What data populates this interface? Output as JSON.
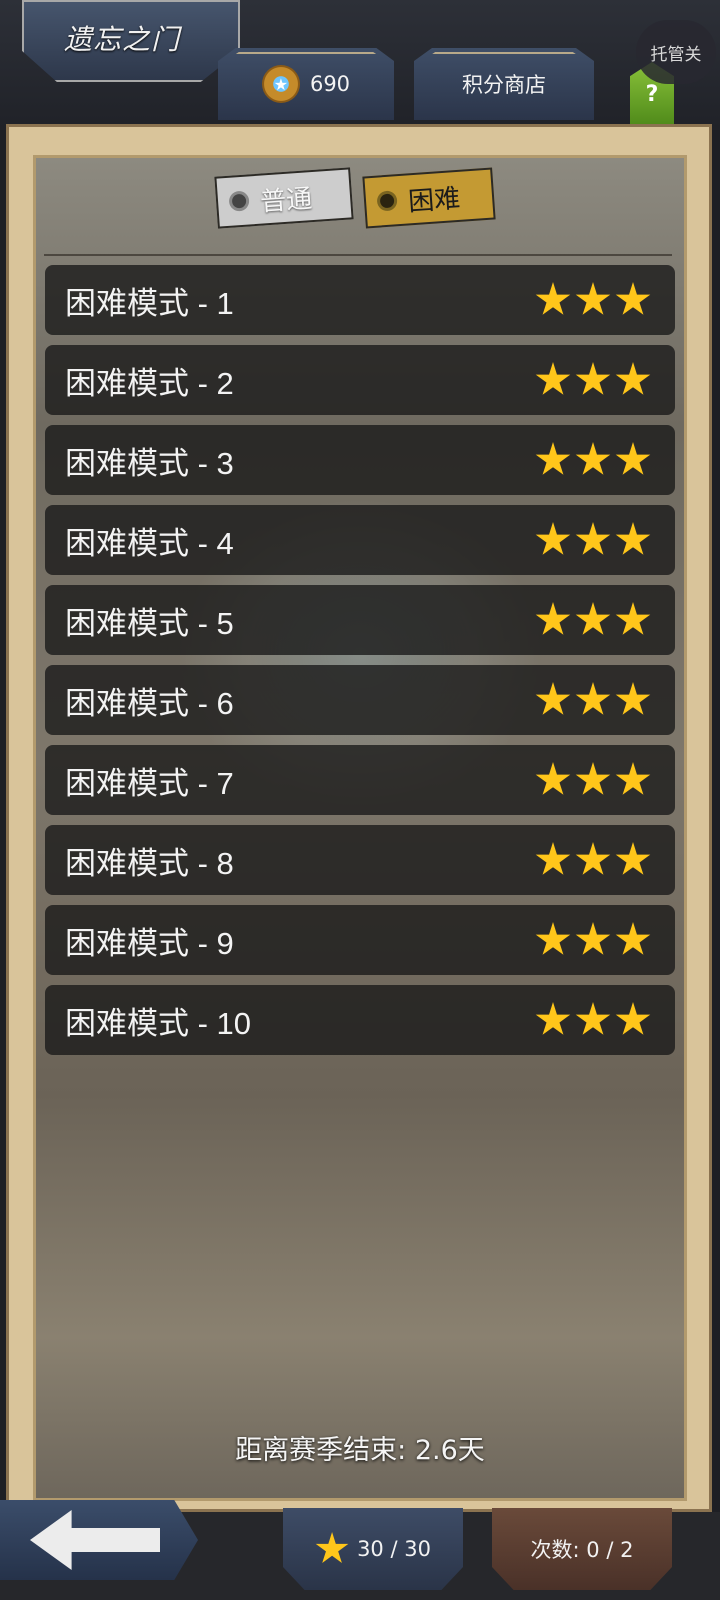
{
  "header": {
    "title": "遗忘之门",
    "coins_value": "690",
    "shop_label": "积分商店",
    "help_label": "?",
    "auto_label": "托管关"
  },
  "tabs": [
    {
      "label": "普通",
      "selected": false
    },
    {
      "label": "困难",
      "selected": true
    }
  ],
  "levels": [
    {
      "label": "困难模式 - 1",
      "stars": 3
    },
    {
      "label": "困难模式 - 2",
      "stars": 3
    },
    {
      "label": "困难模式 - 3",
      "stars": 3
    },
    {
      "label": "困难模式 - 4",
      "stars": 3
    },
    {
      "label": "困难模式 - 5",
      "stars": 3
    },
    {
      "label": "困难模式 - 6",
      "stars": 3
    },
    {
      "label": "困难模式 - 7",
      "stars": 3
    },
    {
      "label": "困难模式 - 8",
      "stars": 3
    },
    {
      "label": "困难模式 - 9",
      "stars": 3
    },
    {
      "label": "困难模式 - 10",
      "stars": 3
    }
  ],
  "season_text": "距离赛季结束: 2.6天",
  "footer": {
    "stars_total": "30 / 30",
    "attempts": "次数: 0 / 2"
  },
  "colors": {
    "star": "#ffc61a",
    "hard_tab": "#c49a33",
    "help_button": "#6aa62a"
  }
}
